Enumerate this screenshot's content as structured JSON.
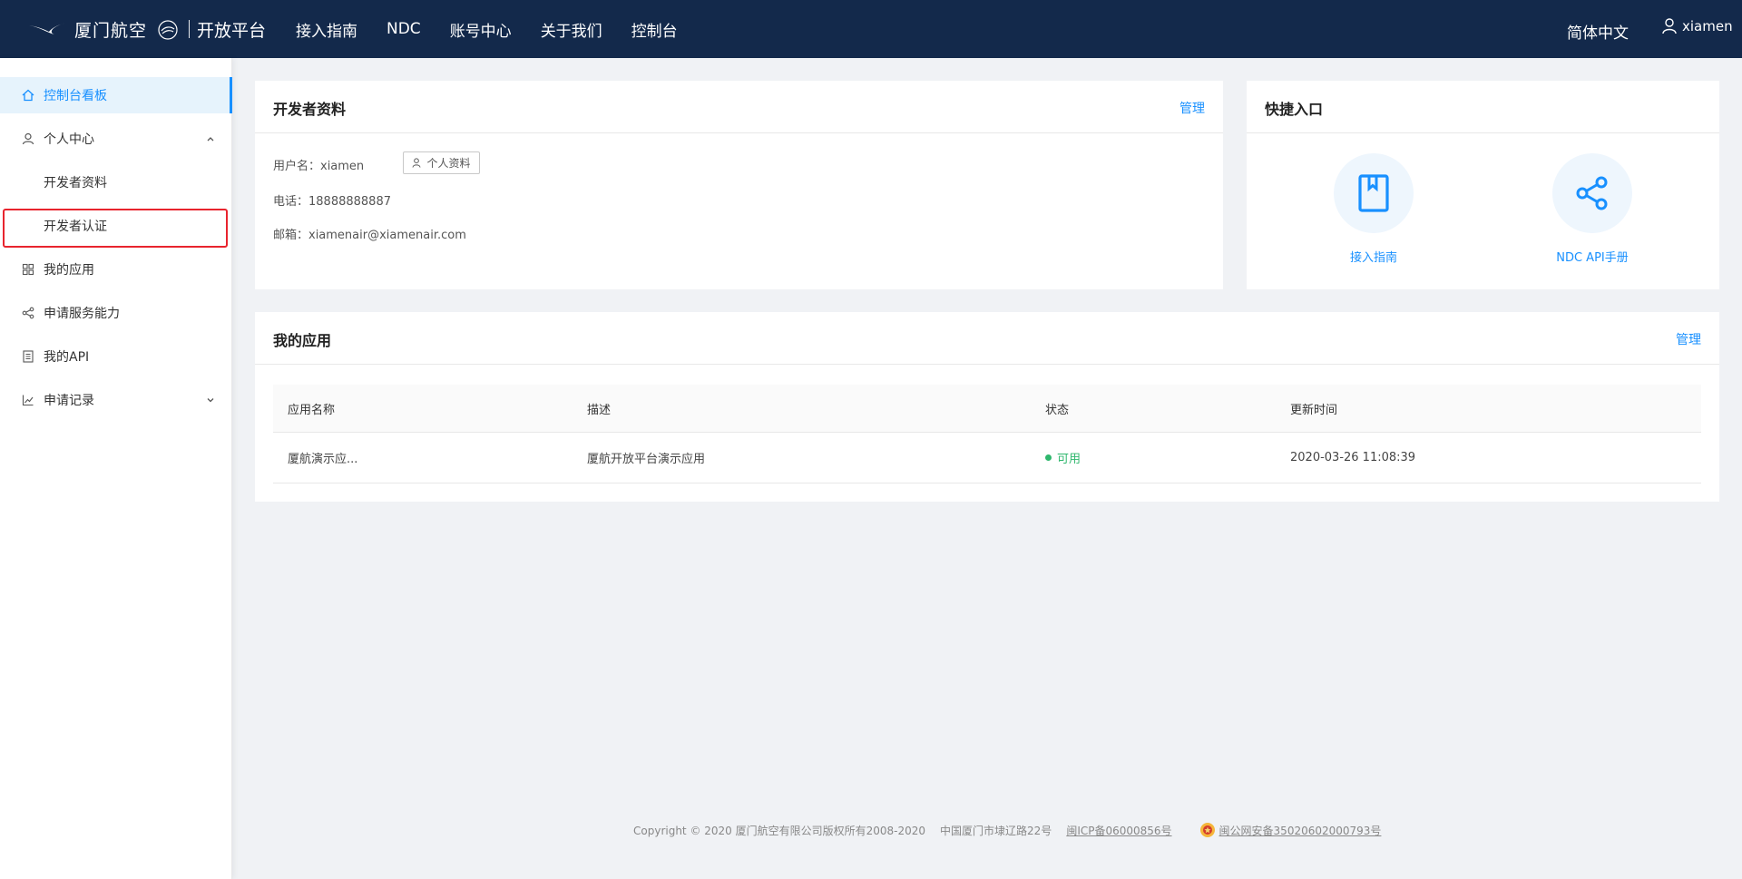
{
  "header": {
    "logo_text": "厦门航空",
    "platform": "开放平台",
    "nav": [
      "接入指南",
      "NDC",
      "账号中心",
      "关于我们",
      "控制台"
    ],
    "language": "简体中文",
    "username": "xiamen"
  },
  "sidebar": {
    "items": [
      {
        "label": "控制台看板",
        "icon": "home-icon"
      },
      {
        "label": "个人中心",
        "icon": "user-icon"
      },
      {
        "label": "开发者资料"
      },
      {
        "label": "开发者认证"
      },
      {
        "label": "我的应用",
        "icon": "apps-icon"
      },
      {
        "label": "申请服务能力",
        "icon": "share-icon"
      },
      {
        "label": "我的API",
        "icon": "document-icon"
      },
      {
        "label": "申请记录",
        "icon": "chart-icon"
      }
    ]
  },
  "developer": {
    "title": "开发者资料",
    "manage": "管理",
    "username": "用户名：xiamen",
    "profile_button": "个人资料",
    "phone": "电话：18888888887",
    "email": "邮箱：xiamenair@xiamenair.com"
  },
  "quick": {
    "title": "快捷入口",
    "items": [
      "接入指南",
      "NDC API手册"
    ]
  },
  "apps": {
    "title": "我的应用",
    "manage": "管理",
    "columns": [
      "应用名称",
      "描述",
      "状态",
      "更新时间"
    ],
    "rows": [
      {
        "name": "厦航演示应...",
        "desc": "厦航开放平台演示应用",
        "status": "可用",
        "updated": "2020-03-26 11:08:39"
      }
    ]
  },
  "footer": {
    "copyright": "Copyright © 2020 厦门航空有限公司版权所有2008-2020",
    "address": "中国厦门市埭辽路22号",
    "icp": "闽ICP备06000856号",
    "police": "闽公网安备35020602000793号"
  },
  "colors": {
    "header_bg": "#13294b",
    "accent": "#1890ff",
    "status_ok": "#2fb76d",
    "highlight": "#e8242e"
  }
}
